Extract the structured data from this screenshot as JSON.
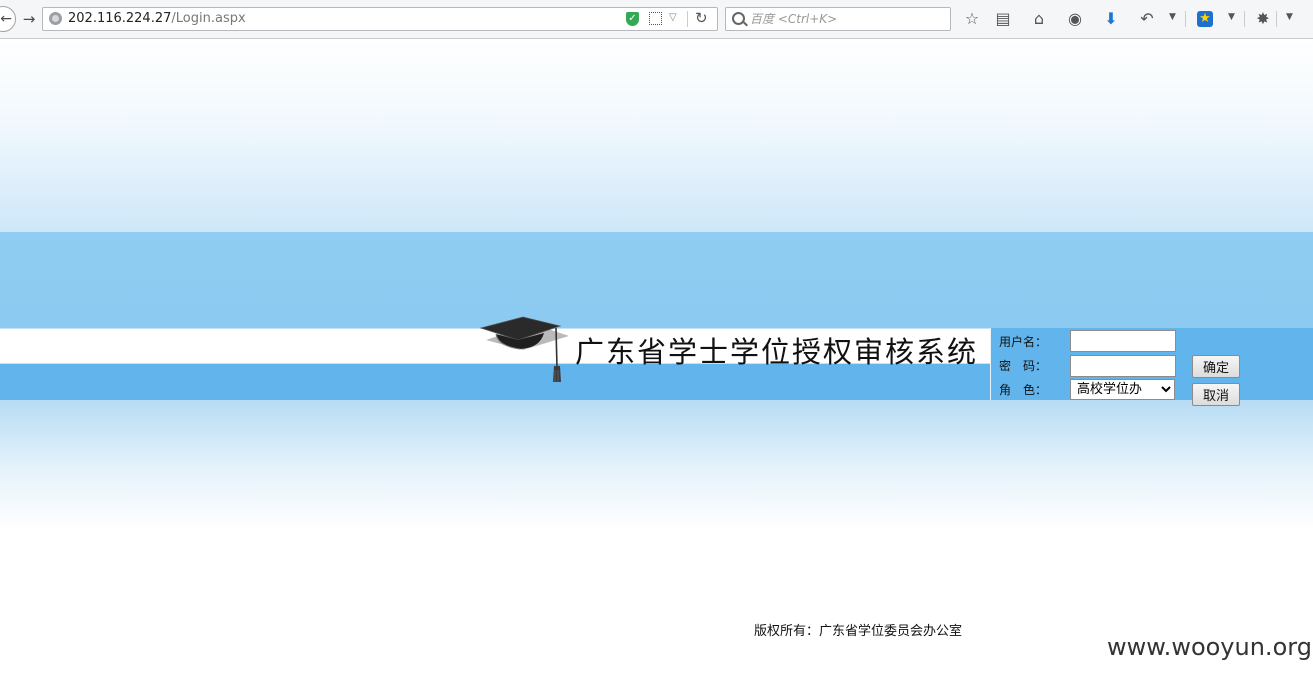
{
  "browser": {
    "url_host": "202.116.224.27",
    "url_path": "/Login.aspx",
    "search_placeholder": "百度 <Ctrl+K>"
  },
  "page": {
    "system_title": "广东省学士学位授权审核系统",
    "login": {
      "username_label": "用户名：",
      "username_value": "",
      "password_label": "密　码：",
      "password_value": "",
      "role_label": "角　色：",
      "role_selected": "高校学位办",
      "confirm_button": "确定",
      "cancel_button": "取消"
    },
    "copyright": "版权所有：广东省学位委员会办公室",
    "watermark": "www.wooyun.org"
  }
}
